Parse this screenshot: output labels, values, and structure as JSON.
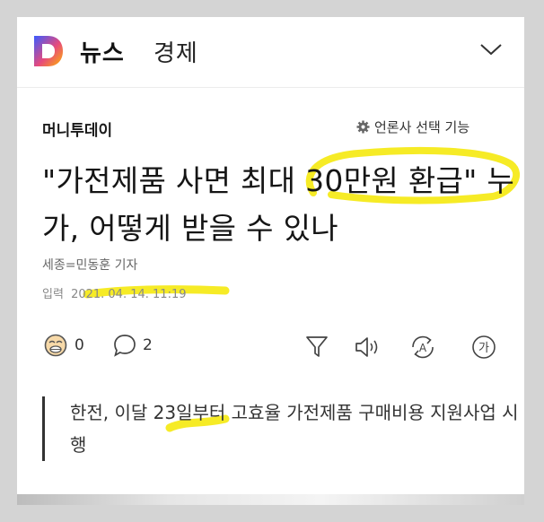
{
  "header": {
    "logo_letter": "D",
    "section": "뉴스",
    "subsection": "경제"
  },
  "article": {
    "press": "머니투데이",
    "press_select_label": "언론사 선택 기능",
    "headline": "\"가전제품 사면 최대 30만원 환급\" 누가, 어떻게 받을 수 있나",
    "reporter": "세종=민동훈 기자",
    "input_label": "입력",
    "input_datetime": "2021. 04. 14. 11:19",
    "summary": "한전, 이달 23일부터 고효율 가전제품 구매비용 지원사업 시행"
  },
  "toolbar": {
    "reaction_count": "0",
    "comment_count": "2",
    "icons": [
      "reaction-icon",
      "comment-icon",
      "summary-icon",
      "listen-icon",
      "translate-icon",
      "font-size-icon"
    ],
    "font_glyph": "가",
    "translate_glyph": "A"
  },
  "colors": {
    "highlight": "#f5e800",
    "logo_gradient": [
      "#3a5bff",
      "#e64a7d",
      "#ffb400"
    ]
  }
}
